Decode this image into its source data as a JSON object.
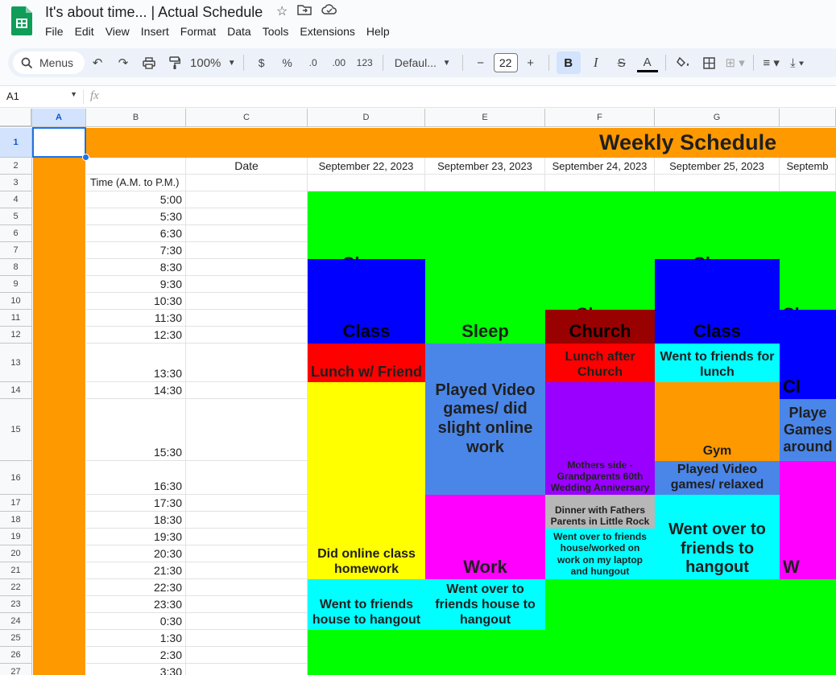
{
  "doc": {
    "title": "It's about time... | Actual Schedule"
  },
  "menu": [
    "File",
    "Edit",
    "View",
    "Insert",
    "Format",
    "Data",
    "Tools",
    "Extensions",
    "Help"
  ],
  "toolbar": {
    "menus_label": "Menus",
    "zoom": "100%",
    "currency": "$",
    "percent": "%",
    "dec_decrease": ".0",
    "dec_increase": ".00",
    "number_format": "123",
    "font_name": "Defaul...",
    "font_size": "22",
    "bold": "B",
    "italic": "I",
    "strike": "S",
    "text_color": "A"
  },
  "formula_bar": {
    "cell_ref": "A1",
    "fx": "fx"
  },
  "columns": [
    "A",
    "B",
    "C",
    "D",
    "E",
    "F",
    "G"
  ],
  "rows": [
    "1",
    "2",
    "3",
    "4",
    "5",
    "6",
    "7",
    "8",
    "9",
    "10",
    "11",
    "12",
    "13",
    "14",
    "15",
    "16",
    "17",
    "18",
    "19",
    "20",
    "21",
    "22",
    "23",
    "24",
    "25",
    "26",
    "27"
  ],
  "sheet": {
    "title": "Weekly Schedule",
    "date_label": "Date",
    "time_label": "Time (A.M. to P.M.)",
    "dates": [
      "September 22, 2023",
      "September 23, 2023",
      "September 24, 2023",
      "September 25, 2023",
      "Septemb"
    ],
    "times": [
      "5:00",
      "5:30",
      "6:30",
      "7:30",
      "8:30",
      "9:30",
      "10:30",
      "11:30",
      "12:30",
      "13:30",
      "14:30",
      "15:30",
      "16:30",
      "17:30",
      "18:30",
      "19:30",
      "20:30",
      "21:30",
      "22:30",
      "23:30",
      "0:30",
      "1:30",
      "2:30",
      "3:30"
    ]
  },
  "blocks": {
    "d_sleep": "Sleep",
    "d_class": "Class",
    "d_lunch": "Lunch w/ Friend",
    "d_homework": "Did online class homework",
    "d_friends": "Went to friends house to hangout",
    "e_sleep": "Sleep",
    "e_games": "Played Video games/ did slight online work",
    "e_work": "Work",
    "e_friends": "Went over to friends house to hangout",
    "f_sleep": "Sleep",
    "f_church": "Church",
    "f_lunch": "Lunch after Church",
    "f_anniv": "Mothers side - Grandparents 60th Wedding Anniversary",
    "f_dinner": "Dinner with Fathers Parents in Little Rock",
    "f_friends": "Went over to friends house/worked on work on my laptop and hungout",
    "g_sleep": "Sleep",
    "g_class": "Class",
    "g_lunch": "Went to friends for lunch",
    "g_gym": "Gym",
    "g_games": "Played Video games/ relaxed",
    "g_hangout": "Went over to friends to hangout",
    "h_sleep": "Sle",
    "h_class": "Cl",
    "h_games": "Playe Games around",
    "h_work": "W"
  },
  "colors": {
    "orange": "#ff9900",
    "green": "#00ff00",
    "blue": "#0000ff",
    "red": "#ff0000",
    "yellow": "#ffff00",
    "cyan": "#00ffff",
    "light_blue": "#4a86e8",
    "magenta": "#ff00ff",
    "dark_red": "#990000",
    "purple": "#9900ff",
    "gray": "#b7b7b7"
  }
}
